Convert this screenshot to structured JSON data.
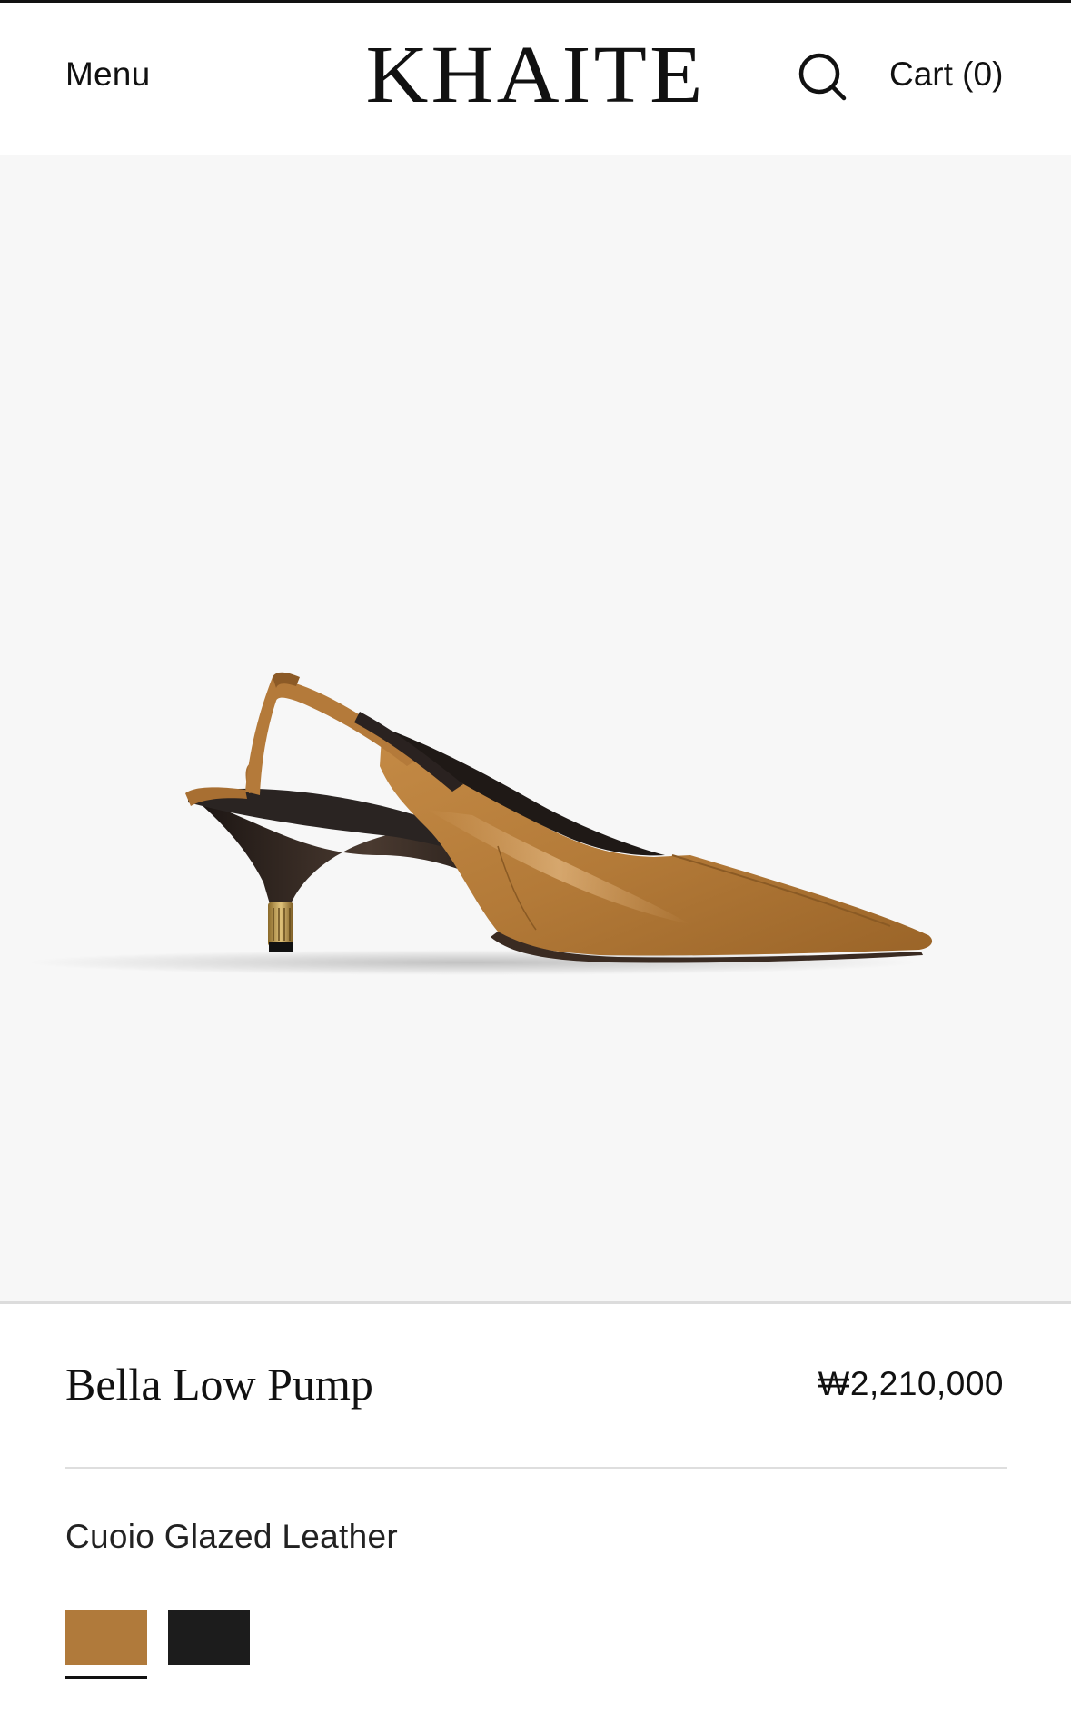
{
  "header": {
    "menu_label": "Menu",
    "brand": "KHAITE",
    "search_icon": "search-icon",
    "cart_label": "Cart (0)"
  },
  "hero": {
    "image_subject": "slingback-pump-photo",
    "background_color": "#f7f7f7"
  },
  "product": {
    "name": "Bella Low Pump",
    "price": "₩2,210,000",
    "color_name": "Cuoio Glazed Leather",
    "swatches": [
      {
        "name": "Cuoio",
        "color": "#b07a3b",
        "selected": true
      },
      {
        "name": "Black",
        "color": "#1c1c1c",
        "selected": false
      }
    ]
  }
}
